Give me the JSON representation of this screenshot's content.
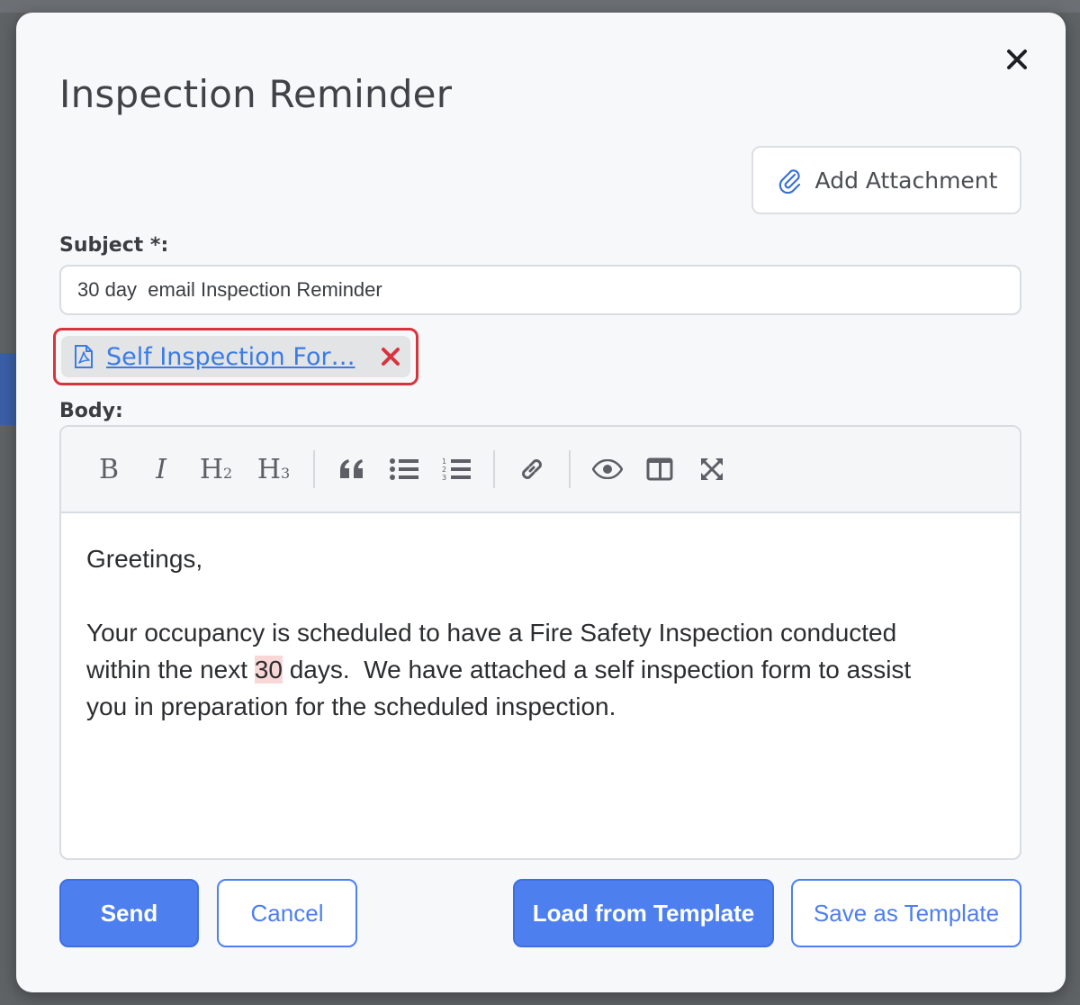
{
  "modal": {
    "title": "Inspection Reminder",
    "close_icon": "close-icon"
  },
  "attachment_button": {
    "label": "Add Attachment",
    "icon": "paperclip-icon"
  },
  "subject": {
    "label": "Subject *:",
    "value": "30 day  email Inspection Reminder"
  },
  "attachment": {
    "name": "Self Inspection For…",
    "icon": "pdf-file-icon",
    "remove_icon": "remove-icon",
    "highlight_color": "#d8343f"
  },
  "body": {
    "label": "Body:",
    "greeting": "Greetings,",
    "line1": "Your occupancy is scheduled to have a Fire Safety Inspection conducted",
    "line2_before": "within the next ",
    "line2_highlight": "30",
    "line2_after": " days.  We have attached a self inspection form to assist",
    "line3": "you in preparation for the scheduled inspection."
  },
  "toolbar": {
    "bold": "B",
    "italic": "I",
    "h2": "H",
    "h2_sub": "2",
    "h3": "H",
    "h3_sub": "3",
    "icons": [
      "bold-icon",
      "italic-icon",
      "heading-2-icon",
      "heading-3-icon",
      "quote-icon",
      "unordered-list-icon",
      "ordered-list-icon",
      "link-icon",
      "preview-icon",
      "side-by-side-icon",
      "fullscreen-icon"
    ]
  },
  "buttons": {
    "send": "Send",
    "cancel": "Cancel",
    "load_template": "Load from Template",
    "save_template": "Save as Template"
  },
  "colors": {
    "primary": "#4e7fef",
    "link": "#3b7be6",
    "danger": "#d8343f"
  }
}
